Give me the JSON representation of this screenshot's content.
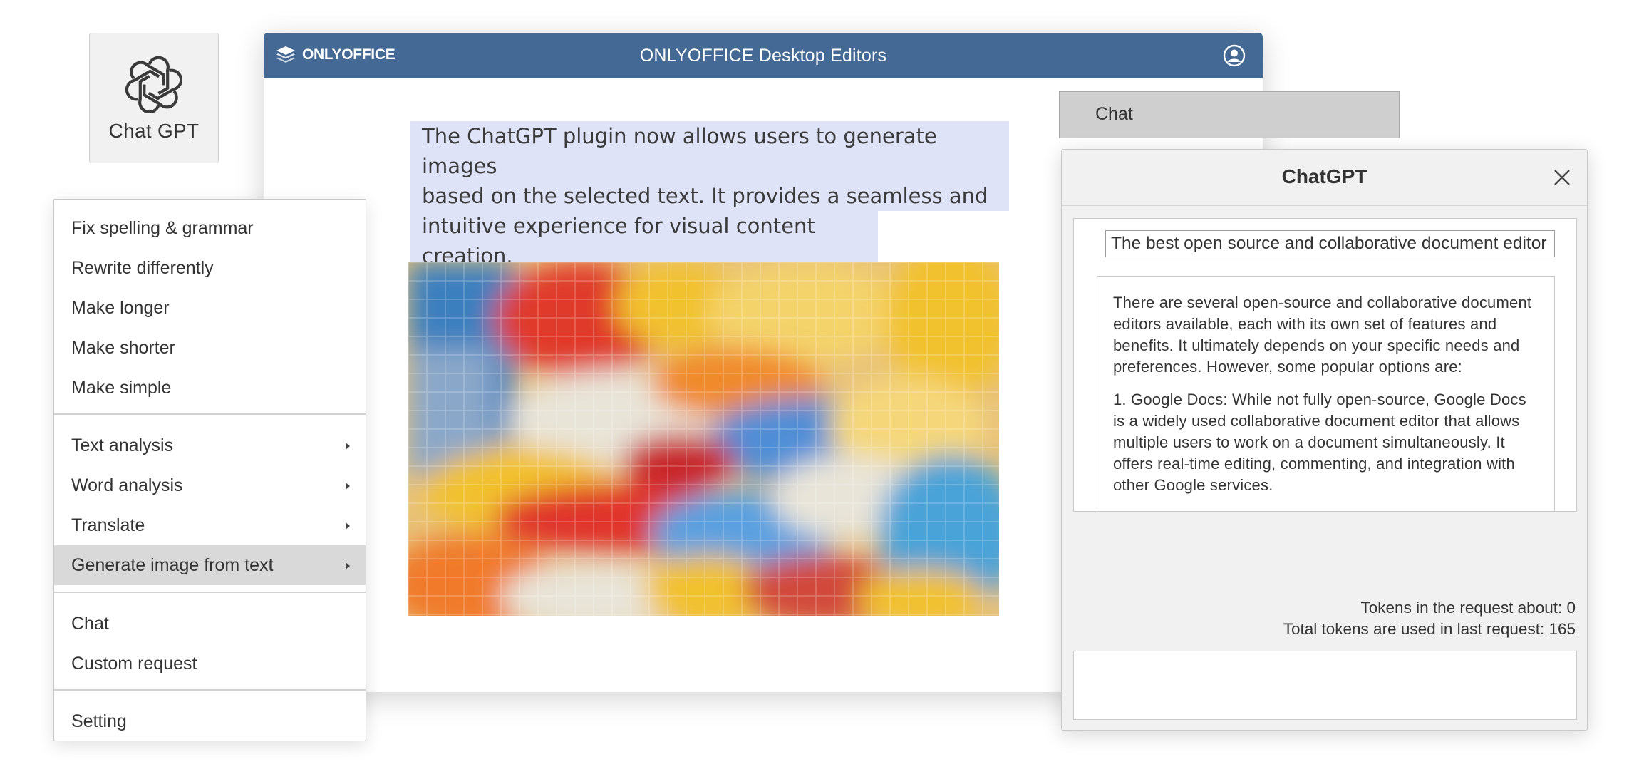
{
  "plugin_tile": {
    "label": "Chat GPT",
    "icon": "openai-logo-icon"
  },
  "editor": {
    "brand": "ONLYOFFICE",
    "title": "ONLYOFFICE Desktop Editors",
    "selected_text": [
      "The ChatGPT plugin now allows users to generate images",
      "based on the selected text. It provides a seamless and",
      "intuitive experience for visual content creation."
    ],
    "highlight_color": "#dee3f7",
    "header_color": "#446995"
  },
  "context_menu": {
    "group1": [
      "Fix spelling & grammar",
      "Rewrite differently",
      "Make longer",
      "Make shorter",
      "Make simple"
    ],
    "group2": [
      "Text analysis",
      "Word analysis",
      "Translate",
      "Generate image from text"
    ],
    "highlighted": "Generate image from text",
    "group3": [
      "Chat",
      "Custom request"
    ],
    "group4": [
      "Setting"
    ]
  },
  "chat_bar": {
    "label": "Chat"
  },
  "chat_panel": {
    "title": "ChatGPT",
    "user_message": "The best open source and collaborative document editor",
    "assistant_message": [
      "There are several open-source and collaborative document editors available, each with its own set of features and benefits. It ultimately depends on your specific needs and preferences. However, some popular options are:",
      "1. Google Docs: While not fully open-source, Google Docs is a widely used collaborative document editor that allows multiple users to work on a document simultaneously. It offers real-time editing, commenting, and integration with other Google services."
    ],
    "tokens_request": "Tokens in the request about: 0",
    "tokens_total": "Total tokens are used in last request: 165",
    "input_value": ""
  }
}
